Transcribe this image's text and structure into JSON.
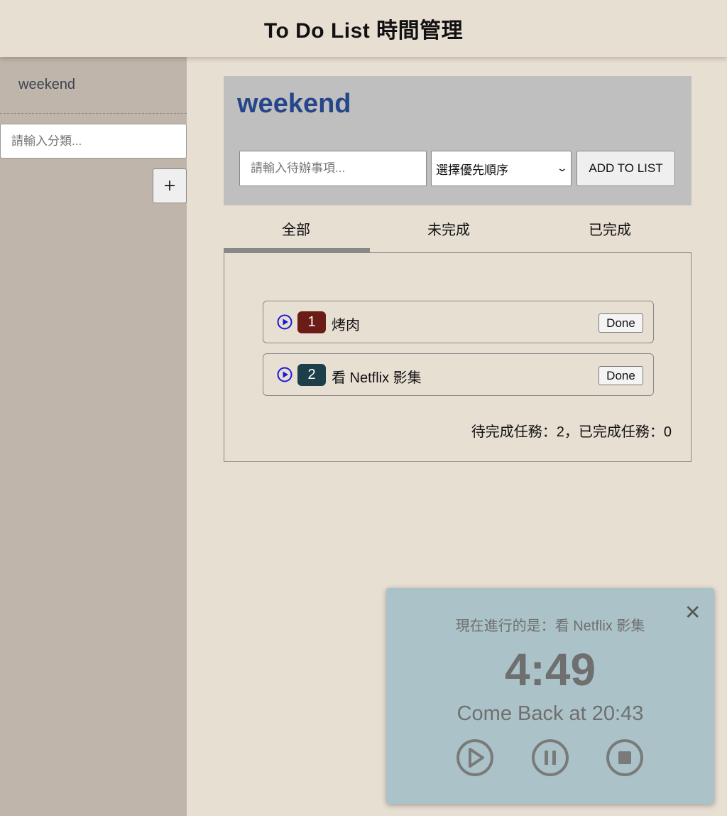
{
  "header": {
    "title": "To Do List 時間管理"
  },
  "sidebar": {
    "category": "weekend",
    "category_placeholder": "請輸入分類...",
    "add_label": "+"
  },
  "panel": {
    "title": "weekend",
    "todo_placeholder": "請輸入待辦事項...",
    "priority_selected": "選擇優先順序",
    "add_button": "ADD TO LIST"
  },
  "tabs": [
    {
      "label": "全部",
      "active": true
    },
    {
      "label": "未完成",
      "active": false
    },
    {
      "label": "已完成",
      "active": false
    }
  ],
  "todos": [
    {
      "priority": "1",
      "text": "烤肉",
      "badge_color": "#6b1c17",
      "done_label": "Done"
    },
    {
      "priority": "2",
      "text": "看 Netflix 影集",
      "badge_color": "#1c3f4a",
      "done_label": "Done"
    }
  ],
  "summary": "待完成任務：2，已完成任務：0",
  "timer": {
    "current": "現在進行的是：看 Netflix 影集",
    "countdown": "4:49",
    "come_back": "Come Back at 20:43",
    "close_icon": "close-icon"
  },
  "colors": {
    "accent_title": "#27458a",
    "play_icon": "#1a1ad6",
    "timer_bg": "#abc3c8"
  }
}
